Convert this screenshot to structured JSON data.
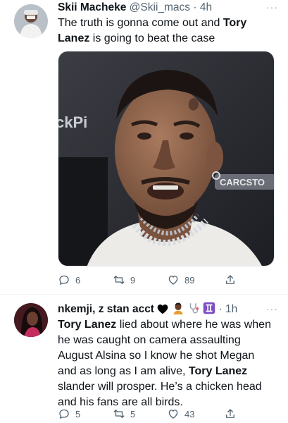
{
  "tweets": [
    {
      "display_name": "Skii Macheke",
      "handle": "@Skii_macs",
      "separator": "·",
      "time": "4h",
      "more": "···",
      "text_parts": [
        "The truth is gonna come out and ",
        "Tory Lanez",
        " is going to beat the case"
      ],
      "text_line2_prefix": "",
      "media_sign_left": "ckPi",
      "media_sign_badge": "CARCSTO",
      "counts": {
        "replies": "6",
        "retweets": "9",
        "likes": "89"
      }
    },
    {
      "display_name": "nkemji, z stan acct",
      "separator": "·",
      "time": "1h",
      "more": "···",
      "name_emojis": [
        "black-heart",
        "person-emoji",
        "stethoscope-emoji",
        "gemini-emoji"
      ],
      "text_parts": [
        "Tory Lanez",
        " lied about where he was when he was caught on camera assaulting August Alsina so I know he shot Megan and as long as I am alive, ",
        "Tory Lanez",
        " slander will prosper. He’s a chicken head and his fans are all birds."
      ],
      "counts": {
        "replies": "5",
        "retweets": "5",
        "likes": "43"
      }
    }
  ],
  "colors": {
    "text": "#0f1419",
    "secondary": "#536471",
    "divider": "#eff3f4",
    "gemini_purple": "#7d4fc3"
  }
}
